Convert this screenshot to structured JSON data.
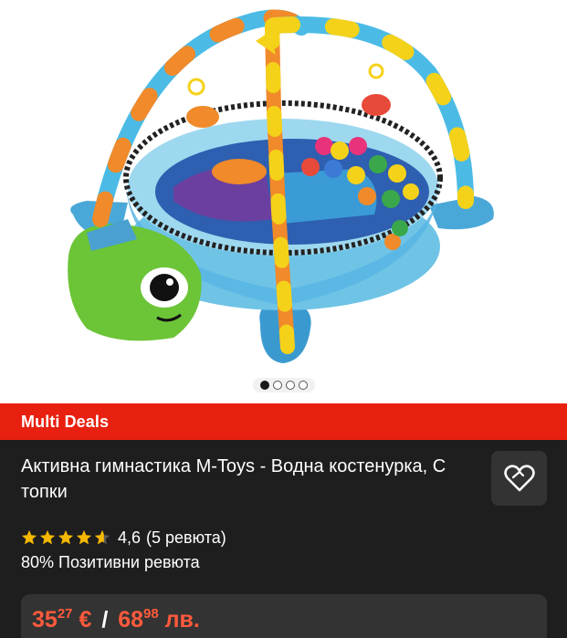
{
  "gallery": {
    "image_alt": "Baby activity gym turtle with ball pit",
    "page_indicator": {
      "count": 4,
      "active_index": 0
    }
  },
  "banner": {
    "label": "Multi Deals"
  },
  "product": {
    "title": "Активна гимнастика M-Toys - Водна костенурка, С топки",
    "rating_value": "4,6",
    "rating_count": "(5 ревюта)",
    "stars": 4.6,
    "positive_reviews": "80% Позитивни ревюта"
  },
  "price": {
    "current_main": "35",
    "current_cents": "27",
    "current_currency": " €",
    "separator": "/",
    "alt_main": "68",
    "alt_cents": "98",
    "alt_currency": " лв."
  },
  "colors": {
    "accent_red": "#e8200f",
    "price_red": "#ff5a3c",
    "star_yellow": "#f5b800",
    "background": "#1e1e1e",
    "card": "#333333"
  },
  "icons": {
    "favorite": "heart-outline-icon",
    "star": "star-icon"
  }
}
